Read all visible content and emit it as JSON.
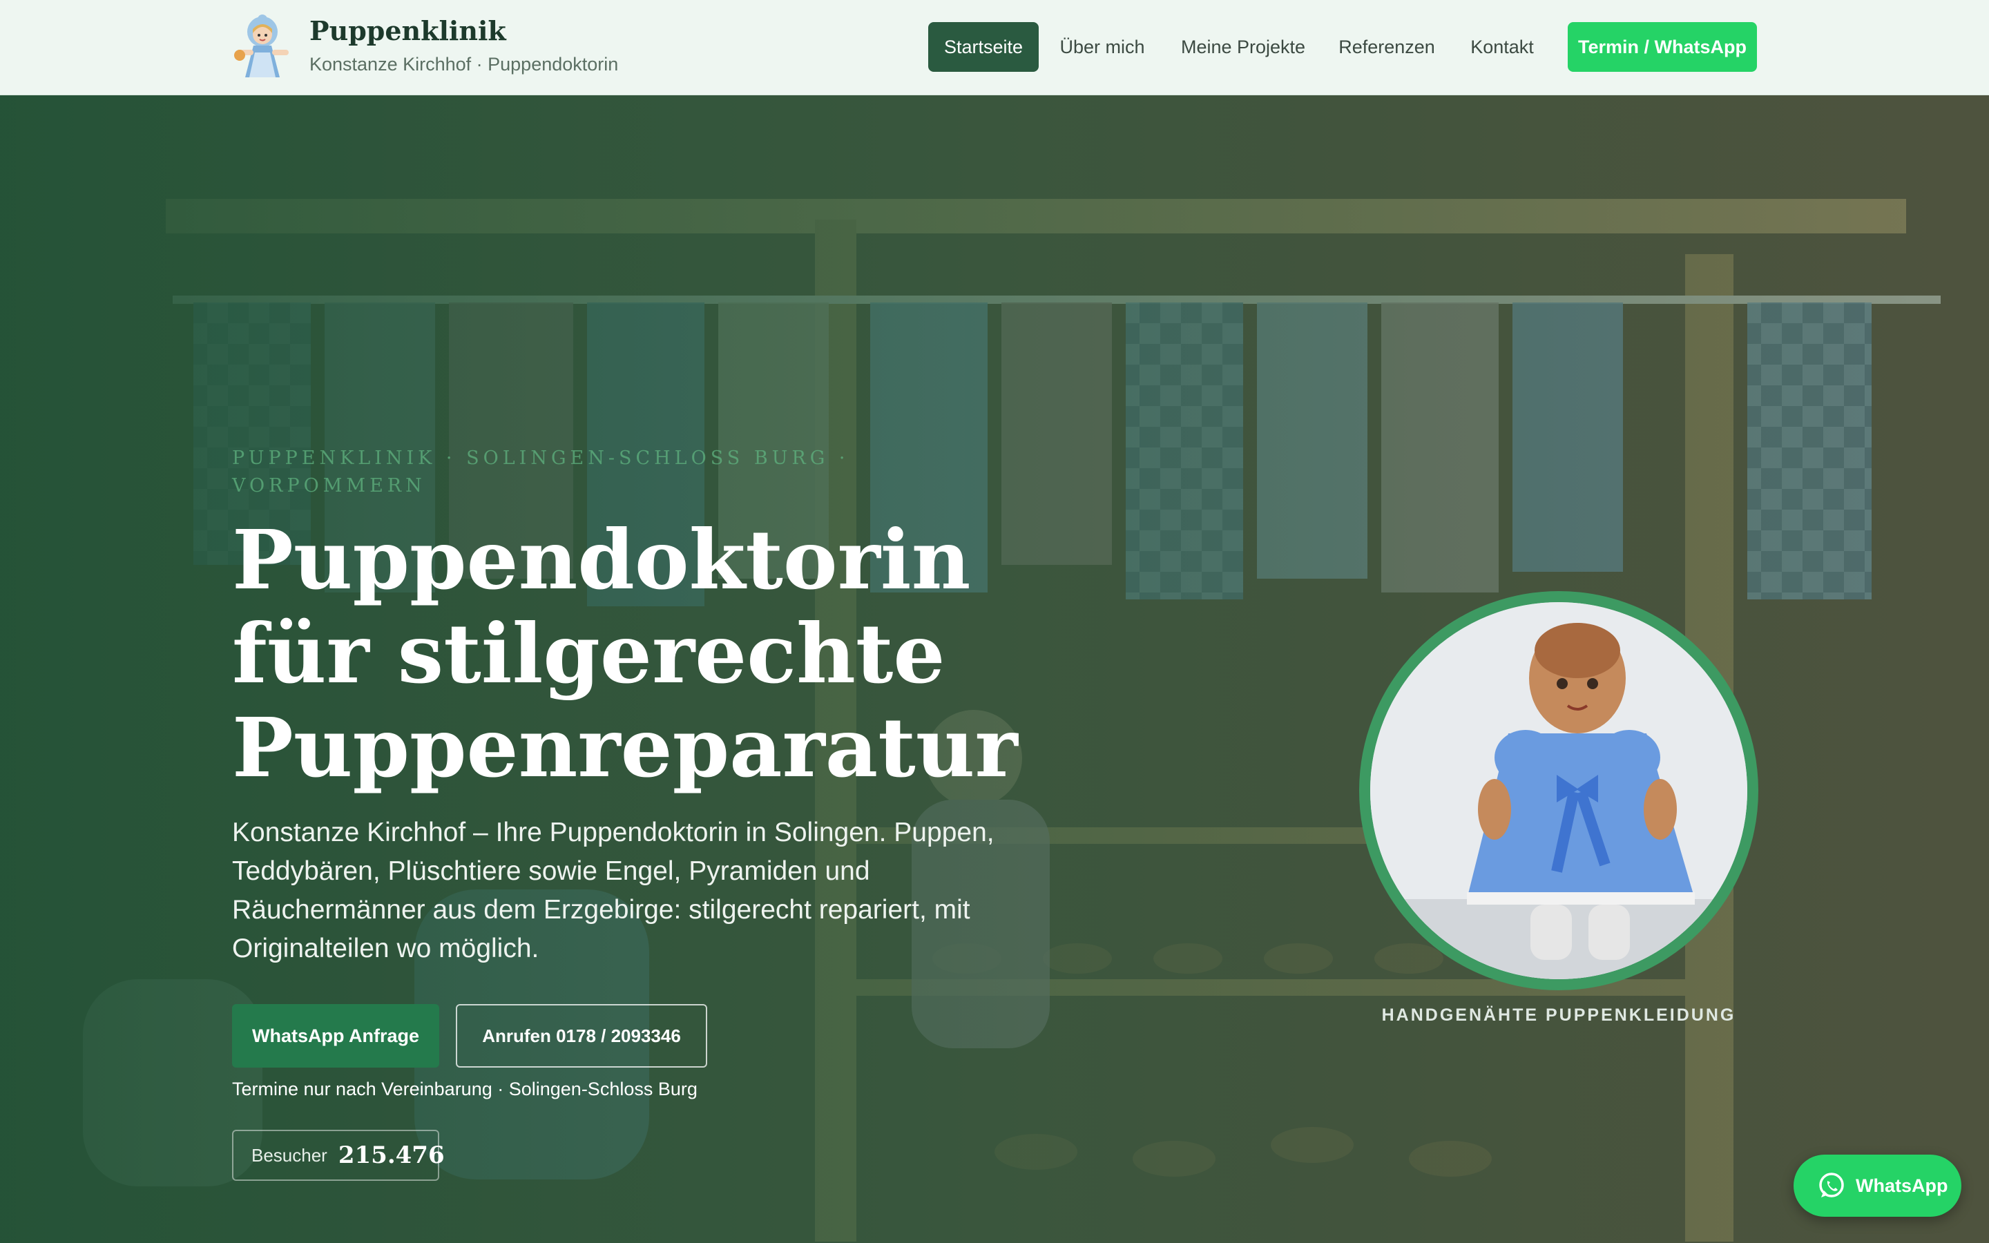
{
  "header": {
    "brand_name": "Puppenklinik",
    "brand_sub": "Konstanze Kirchhof · Puppendoktorin",
    "logo_icon": "doll-logo-icon",
    "nav": [
      {
        "label": "Startseite",
        "active": true
      },
      {
        "label": "Über mich"
      },
      {
        "label": "Meine Projekte"
      },
      {
        "label": "Referenzen"
      },
      {
        "label": "Kontakt"
      }
    ],
    "cta_label": "Termin / WhatsApp"
  },
  "hero": {
    "eyebrow": "PUPPENKLINIK · SOLINGEN-SCHLOSS BURG · VORPOMMERN",
    "title": "Puppendoktorin für stilgerechte Puppenreparatur",
    "lead": "Konstanze Kirchhof – Ihre Puppendoktorin in Solingen. Puppen, Teddybären, Plüschtiere sowie Engel, Pyramiden und Räuchermänner aus dem Erzgebirge: stilgerecht repariert, mit Originalteilen wo möglich.",
    "whatsapp_button": "WhatsApp Anfrage",
    "call_button": "Anrufen 0178 / 2093346",
    "note": "Termine nur nach Vereinbarung · Solingen-Schloss Burg",
    "visitor_label": "Besucher",
    "visitor_count": "215.476",
    "photo_caption": "HANDGENÄHTE PUPPENKLEIDUNG"
  },
  "floating": {
    "whatsapp_label": "WhatsApp",
    "icon": "whatsapp-icon"
  },
  "colors": {
    "primary": "#2a5a40",
    "accent": "#25d366",
    "ring": "#3d9a62",
    "header_bg": "#eef6f1"
  }
}
